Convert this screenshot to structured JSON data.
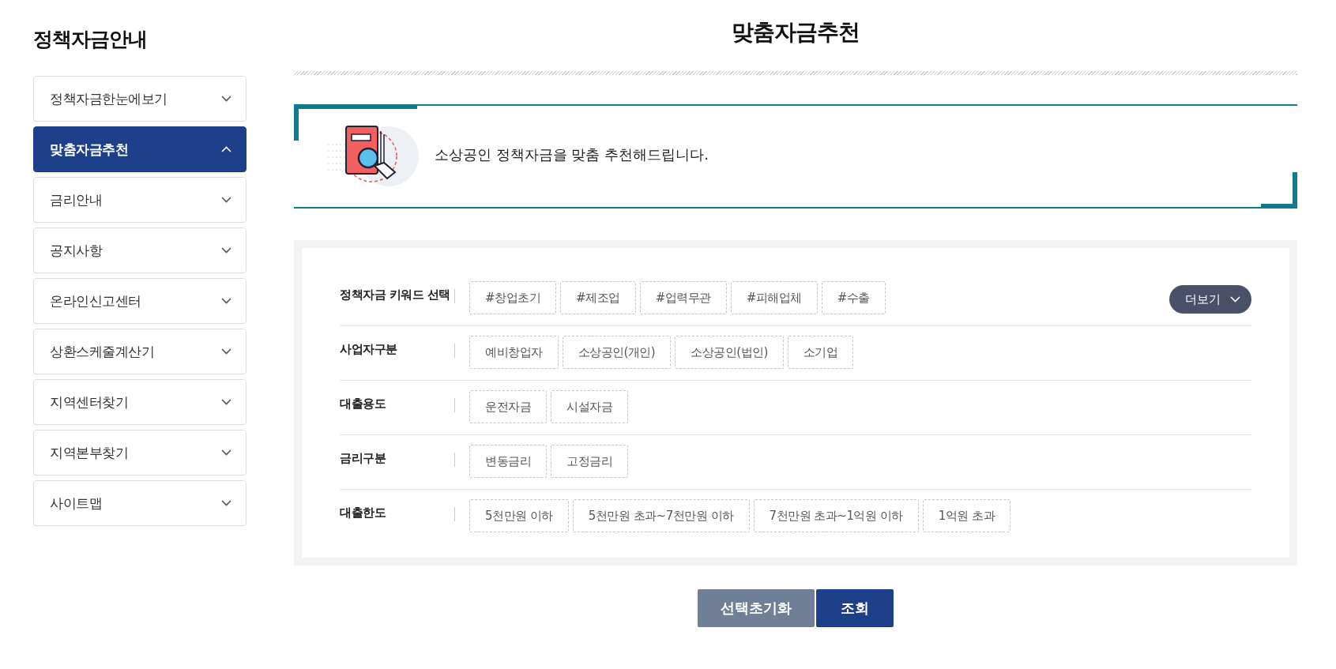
{
  "sidebar": {
    "title": "정책자금안내",
    "items": [
      {
        "label": "정책자금한눈에보기",
        "selected": false
      },
      {
        "label": "맞춤자금추천",
        "selected": true
      },
      {
        "label": "금리안내",
        "selected": false
      },
      {
        "label": "공지사항",
        "selected": false
      },
      {
        "label": "온라인신고센터",
        "selected": false
      },
      {
        "label": "상환스케줄계산기",
        "selected": false
      },
      {
        "label": "지역센터찾기",
        "selected": false
      },
      {
        "label": "지역본부찾기",
        "selected": false
      },
      {
        "label": "사이트맵",
        "selected": false
      }
    ]
  },
  "page_title": "맞춤자금추천",
  "intro": {
    "text": "소상공인 정책자금을 맞춤 추천해드립니다."
  },
  "filters": {
    "more_button": "더보기",
    "rows": [
      {
        "label": "정책자금 키워드 선택",
        "options": [
          "#창업초기",
          "#제조업",
          "#업력무관",
          "#피해업체",
          "#수출"
        ]
      },
      {
        "label": "사업자구분",
        "options": [
          "예비창업자",
          "소상공인(개인)",
          "소상공인(법인)",
          "소기업"
        ]
      },
      {
        "label": "대출용도",
        "options": [
          "운전자금",
          "시설자금"
        ]
      },
      {
        "label": "금리구분",
        "options": [
          "변동금리",
          "고정금리"
        ]
      },
      {
        "label": "대출한도",
        "options": [
          "5천만원 이하",
          "5천만원 초과~7천만원 이하",
          "7천만원 초과~1억원 이하",
          "1억원 초과"
        ]
      }
    ]
  },
  "actions": [
    {
      "label": "선택초기화",
      "kind": "reset"
    },
    {
      "label": "조회",
      "kind": "submit"
    }
  ]
}
